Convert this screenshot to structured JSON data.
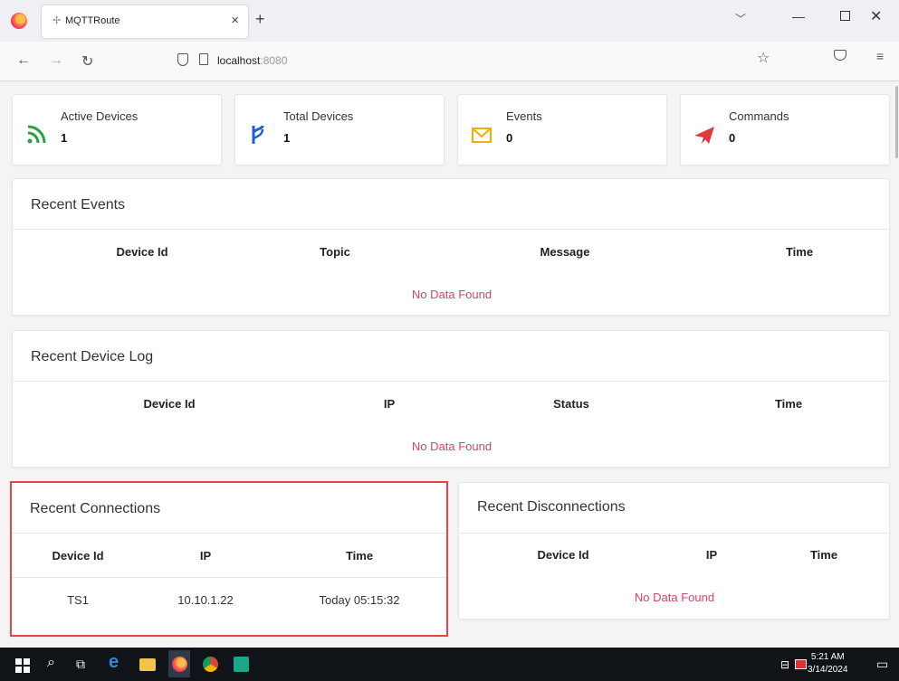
{
  "browser": {
    "tab_title": "MQTTRoute",
    "url_host": "localhost",
    "url_port": ":8080"
  },
  "stats": [
    {
      "label": "Active Devices",
      "value": "1",
      "icon": "rss-icon",
      "color": "#2e9e44"
    },
    {
      "label": "Total Devices",
      "value": "1",
      "icon": "fork-icon",
      "color": "#1f5fd6"
    },
    {
      "label": "Events",
      "value": "0",
      "icon": "envelope-icon",
      "color": "#f0b000"
    },
    {
      "label": "Commands",
      "value": "0",
      "icon": "paper-plane-icon",
      "color": "#e03a3a"
    }
  ],
  "recent_events": {
    "title": "Recent Events",
    "columns": [
      "Device Id",
      "Topic",
      "Message",
      "Time"
    ],
    "empty": "No Data Found"
  },
  "recent_device_log": {
    "title": "Recent Device Log",
    "columns": [
      "Device Id",
      "IP",
      "Status",
      "Time"
    ],
    "empty": "No Data Found"
  },
  "recent_connections": {
    "title": "Recent Connections",
    "columns": [
      "Device Id",
      "IP",
      "Time"
    ],
    "rows": [
      {
        "device_id": "TS1",
        "ip": "10.10.1.22",
        "time": "Today 05:15:32"
      }
    ]
  },
  "recent_disconnections": {
    "title": "Recent Disconnections",
    "columns": [
      "Device Id",
      "IP",
      "Time"
    ],
    "empty": "No Data Found"
  },
  "taskbar": {
    "time": "5:21 AM",
    "date": "3/14/2024"
  }
}
